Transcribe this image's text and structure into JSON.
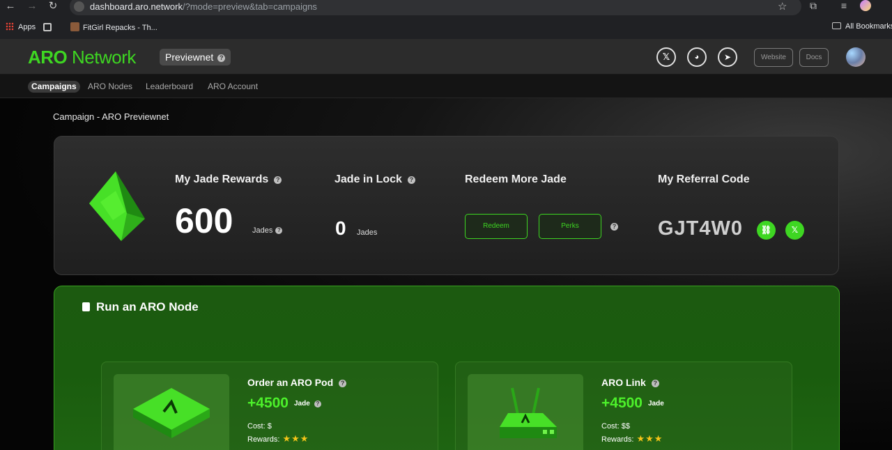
{
  "browser": {
    "url_host": "dashboard.aro.network",
    "url_path": "/?mode=preview&tab=campaigns",
    "bookmarks": {
      "apps": "Apps",
      "fitgirl": "FitGirl Repacks - Th...",
      "all": "All Bookmarks"
    }
  },
  "header": {
    "logo_bold": "ARO",
    "logo_rest": " Network",
    "network_badge": "Previewnet",
    "website_btn": "Website",
    "docs_btn": "Docs"
  },
  "tabs": [
    "Campaigns",
    "ARO Nodes",
    "Leaderboard",
    "ARO Account"
  ],
  "breadcrumb": "Campaign - ARO Previewnet",
  "rewards": {
    "my_jade_title": "My Jade Rewards",
    "my_jade_value": "600",
    "my_jade_unit": "Jades",
    "lock_title": "Jade in Lock",
    "lock_value": "0",
    "lock_unit": "Jades",
    "redeem_title": "Redeem More Jade",
    "redeem_btn": "Redeem",
    "perks_btn": "Perks",
    "referral_title": "My Referral Code",
    "referral_code": "GJT4W0"
  },
  "node_section": {
    "title": "Run an ARO Node",
    "products": [
      {
        "name": "Order an ARO Pod",
        "reward": "+4500",
        "unit": "Jade",
        "cost": "Cost: $",
        "rewards_label": "Rewards:",
        "stars": 3
      },
      {
        "name": "ARO Link",
        "reward": "+4500",
        "unit": "Jade",
        "cost": "Cost: $$",
        "rewards_label": "Rewards:",
        "stars": 3
      }
    ]
  },
  "colors": {
    "accent": "#3ed622",
    "header_bg": "#2c2c2c",
    "node_bg": "#1c5a10"
  }
}
